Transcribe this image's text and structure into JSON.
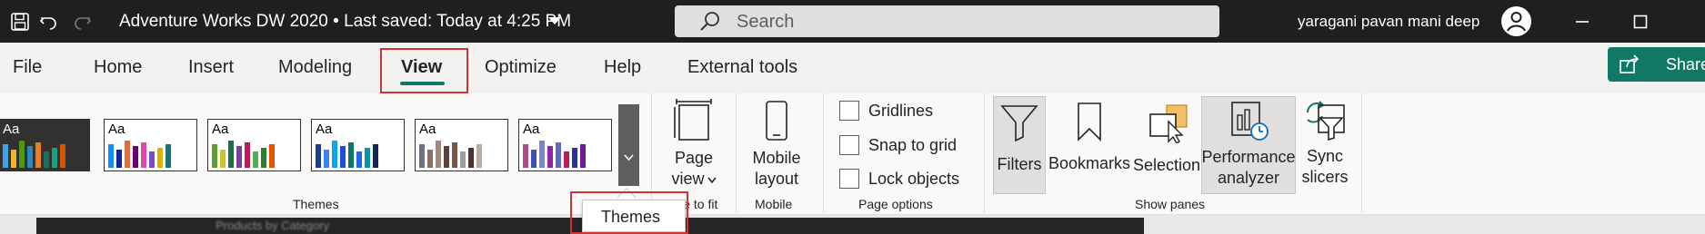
{
  "titlebar": {
    "title": "Adventure Works DW 2020  •  Last saved: Today at 4:25 PM",
    "search_placeholder": "Search",
    "user_name": "yaragani pavan mani deep",
    "icons": [
      "save-icon",
      "undo-icon",
      "redo-icon",
      "title-dropdown-icon",
      "search-icon",
      "user-avatar-icon",
      "minimize-icon",
      "maximize-icon"
    ]
  },
  "tabs": {
    "items": [
      "File",
      "Home",
      "Insert",
      "Modeling",
      "View",
      "Optimize",
      "Help",
      "External tools"
    ],
    "active": "View",
    "share_label": "Share"
  },
  "ribbon": {
    "themes": {
      "group_label": "Themes",
      "swatches": [
        {
          "label": "Aa",
          "bg": "#323130",
          "text": "#ffffff",
          "colors": [
            "#41a5ee",
            "#f0b429",
            "#4e9a06",
            "#2e86c1",
            "#e67e22",
            "#1b6f5f",
            "#16a085",
            "#d35400"
          ]
        },
        {
          "label": "Aa",
          "bg": "#ffffff",
          "text": "#000000",
          "colors": [
            "#118dff",
            "#12239e",
            "#e66c37",
            "#6b007b",
            "#e044a7",
            "#744ec2",
            "#d9b300",
            "#197278"
          ]
        },
        {
          "label": "Aa",
          "bg": "#ffffff",
          "text": "#000000",
          "colors": [
            "#5c9e31",
            "#d4c02a",
            "#1f6e43",
            "#7a3f9c",
            "#c2185b",
            "#4caf50",
            "#2e7d32",
            "#e65100"
          ]
        },
        {
          "label": "Aa",
          "bg": "#ffffff",
          "text": "#000000",
          "colors": [
            "#1e3a8a",
            "#3b82f6",
            "#0ea5e9",
            "#1d4ed8",
            "#0f766e",
            "#2563eb",
            "#0891b2",
            "#172554"
          ]
        },
        {
          "label": "Aa",
          "bg": "#ffffff",
          "text": "#000000",
          "colors": [
            "#6b7280",
            "#8d6e63",
            "#a1887f",
            "#5d4037",
            "#795548",
            "#9e9e9e",
            "#4e342e",
            "#bcaaa4"
          ]
        },
        {
          "label": "Aa",
          "bg": "#ffffff",
          "text": "#000000",
          "colors": [
            "#b04a8a",
            "#3f51b5",
            "#7986cb",
            "#8e24aa",
            "#5c6bc0",
            "#c2185b",
            "#283593",
            "#6a1b9a"
          ]
        }
      ]
    },
    "scale_to_fit": {
      "button_label_line1": "Page",
      "button_label_line2": "view",
      "group_label": "Scale to fit"
    },
    "mobile": {
      "button_label_line1": "Mobile",
      "button_label_line2": "layout",
      "group_label": "Mobile"
    },
    "page_options": {
      "group_label": "Page options",
      "checkboxes": [
        "Gridlines",
        "Snap to grid",
        "Lock objects"
      ],
      "checked": [
        false,
        false,
        false
      ]
    },
    "show_panes": {
      "group_label": "Show panes",
      "filters": "Filters",
      "bookmarks": "Bookmarks",
      "selection": "Selection",
      "performance_line1": "Performance",
      "performance_line2": "analyzer",
      "sync_line1": "Sync",
      "sync_line2": "slicers"
    }
  },
  "tooltip": {
    "text": "Themes"
  },
  "canvas": {
    "blurred_title": "Products by Category"
  },
  "colors": {
    "accent": "#117865",
    "highlight_red": "#d13438",
    "titlebar": "#201f1e"
  }
}
